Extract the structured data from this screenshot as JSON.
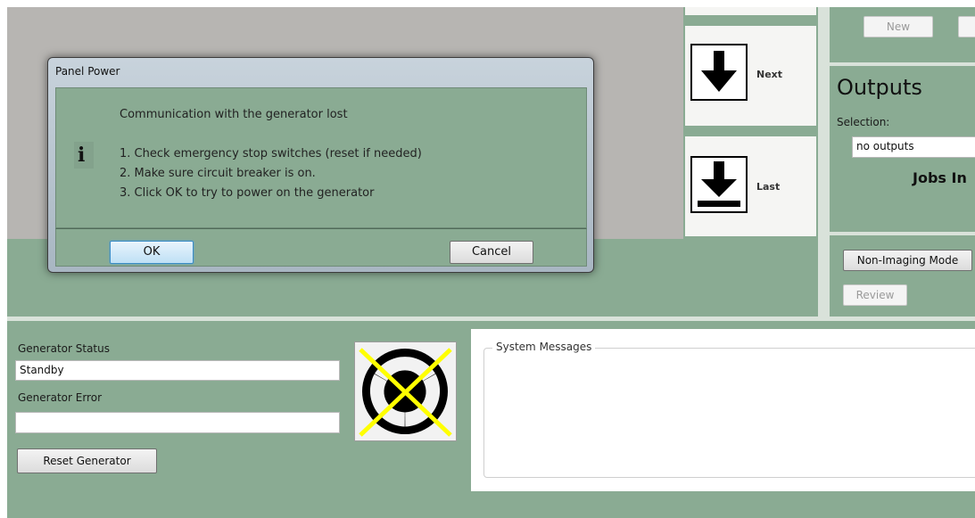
{
  "window": {
    "title": "Panel Power"
  },
  "navigation": {
    "next_label": "Next",
    "last_label": "Last"
  },
  "right_panel": {
    "new_button": "New",
    "outputs_title": "Outputs",
    "selection_label": "Selection:",
    "selection_value": "no outputs",
    "jobs_label": "Jobs In",
    "non_imaging_button": "Non-Imaging Mode",
    "review_button": "Review"
  },
  "dialog": {
    "heading": "Communication with the generator lost",
    "steps": [
      "1. Check emergency stop switches (reset if needed)",
      "2. Make sure circuit breaker is on.",
      "3. Click OK to try to power on the generator"
    ],
    "ok_label": "OK",
    "cancel_label": "Cancel",
    "icon": "info-icon"
  },
  "generator": {
    "status_label": "Generator Status",
    "status_value": "Standby",
    "error_label": "Generator Error",
    "error_value": "",
    "reset_button": "Reset Generator",
    "radiation_icon": "radiation-off-icon"
  },
  "system_messages": {
    "title": "System Messages"
  },
  "colors": {
    "background": "#8aab93",
    "gray_area": "#b7b5b2",
    "dialog_frame": "#b8c6d1",
    "ok_highlight": "#5aa5d8",
    "radiation_cross": "#ffff00"
  }
}
